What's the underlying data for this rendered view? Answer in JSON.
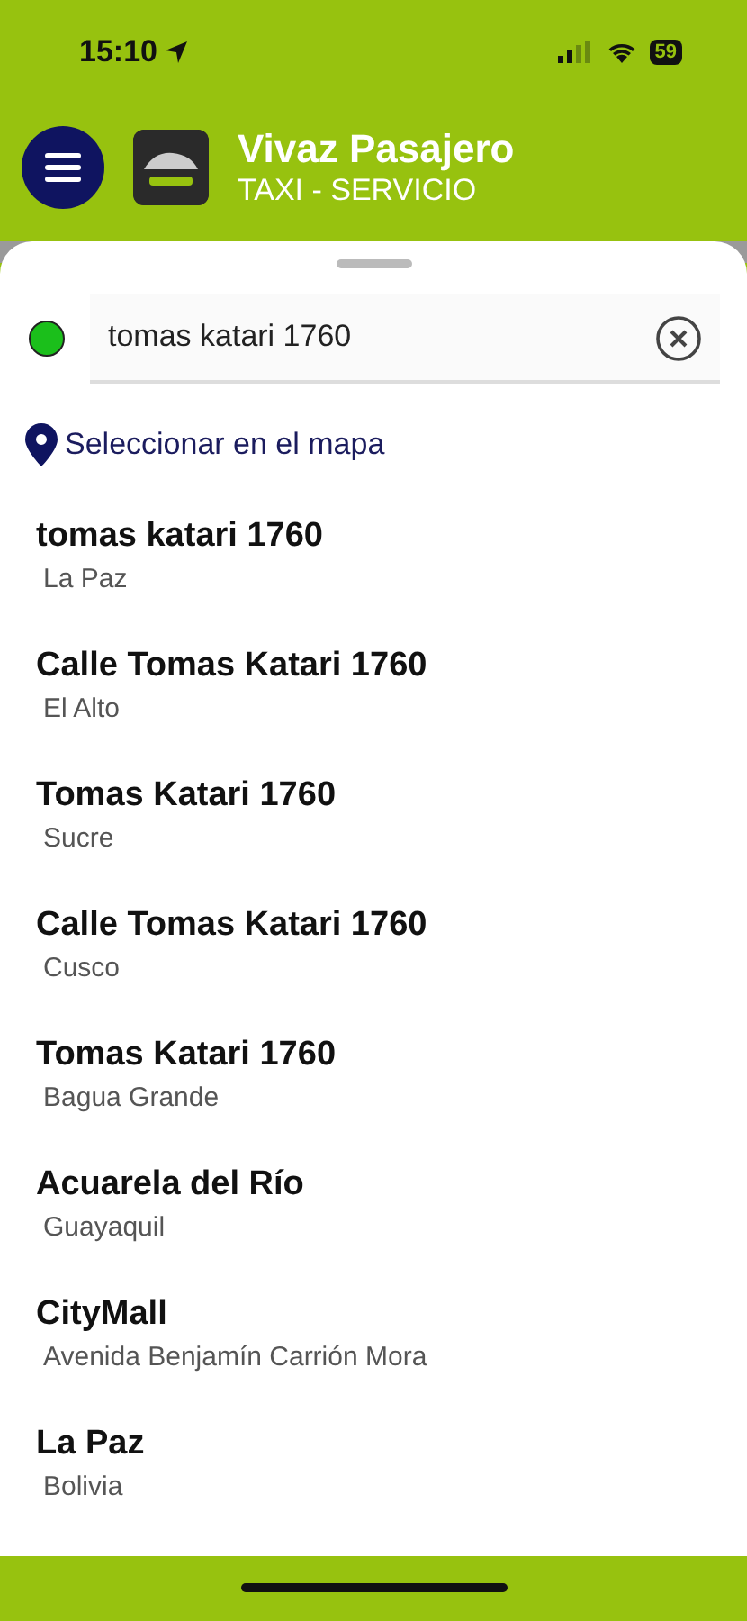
{
  "status_bar": {
    "time": "15:10",
    "battery": "59"
  },
  "header": {
    "title": "Vivaz Pasajero",
    "subtitle": "TAXI - SERVICIO"
  },
  "search": {
    "value": "tomas katari 1760"
  },
  "map_link": "Seleccionar en el mapa",
  "results": [
    {
      "title": "tomas katari 1760",
      "subtitle": "La Paz"
    },
    {
      "title": "Calle Tomas Katari 1760",
      "subtitle": "El Alto"
    },
    {
      "title": "Tomas Katari 1760",
      "subtitle": "Sucre"
    },
    {
      "title": "Calle Tomas Katari 1760",
      "subtitle": "Cusco"
    },
    {
      "title": "Tomas Katari 1760",
      "subtitle": "Bagua Grande"
    },
    {
      "title": "Acuarela del Río",
      "subtitle": "Guayaquil"
    },
    {
      "title": "CityMall",
      "subtitle": "Avenida Benjamín Carrión Mora"
    },
    {
      "title": "La Paz",
      "subtitle": "Bolivia"
    }
  ]
}
